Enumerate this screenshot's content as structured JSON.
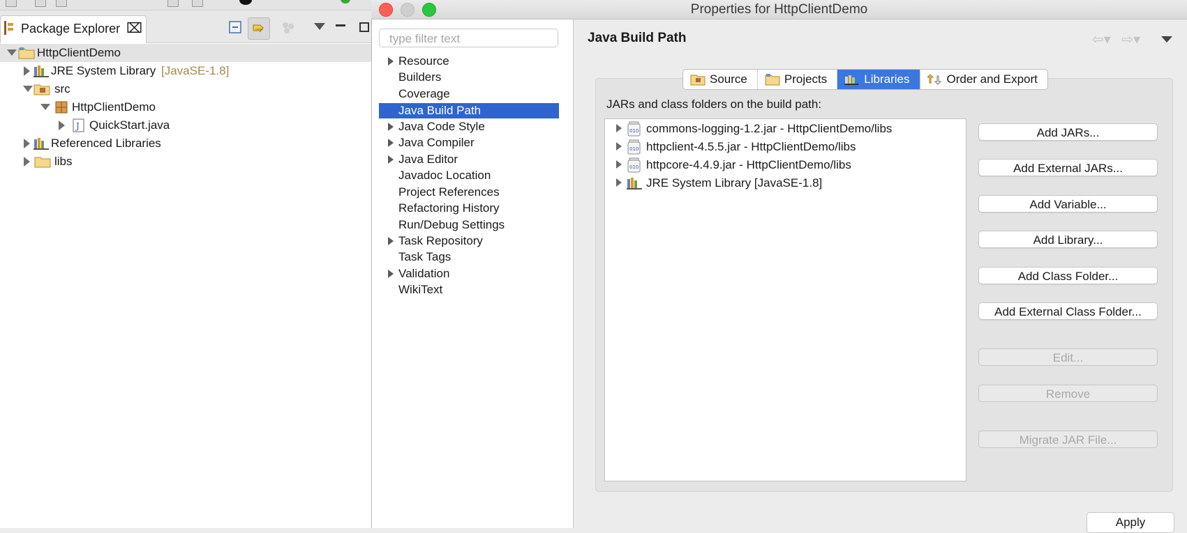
{
  "package_explorer": {
    "title": "Package Explorer",
    "close_glyph": "⌧",
    "tree": [
      {
        "label": "HttpClientDemo",
        "icon": "project-folder-icon"
      },
      {
        "label": "JRE System Library",
        "decoration": "[JavaSE-1.8]",
        "icon": "library-icon"
      },
      {
        "label": "src",
        "icon": "source-folder-icon"
      },
      {
        "label": "HttpClientDemo",
        "icon": "package-icon"
      },
      {
        "label": "QuickStart.java",
        "icon": "java-file-icon"
      },
      {
        "label": "Referenced Libraries",
        "icon": "library-icon"
      },
      {
        "label": "libs",
        "icon": "folder-icon"
      }
    ]
  },
  "dialog": {
    "title": "Properties for HttpClientDemo",
    "filter_placeholder": "type filter text",
    "nav_items": [
      {
        "label": "Resource",
        "expandable": true
      },
      {
        "label": "Builders",
        "expandable": false
      },
      {
        "label": "Coverage",
        "expandable": false
      },
      {
        "label": "Java Build Path",
        "expandable": false,
        "selected": true
      },
      {
        "label": "Java Code Style",
        "expandable": true
      },
      {
        "label": "Java Compiler",
        "expandable": true
      },
      {
        "label": "Java Editor",
        "expandable": true
      },
      {
        "label": "Javadoc Location",
        "expandable": false
      },
      {
        "label": "Project References",
        "expandable": false
      },
      {
        "label": "Refactoring History",
        "expandable": false
      },
      {
        "label": "Run/Debug Settings",
        "expandable": false
      },
      {
        "label": "Task Repository",
        "expandable": true
      },
      {
        "label": "Task Tags",
        "expandable": false
      },
      {
        "label": "Validation",
        "expandable": true
      },
      {
        "label": "WikiText",
        "expandable": false
      }
    ],
    "page_title": "Java Build Path",
    "tabs": [
      {
        "label": "Source",
        "icon": "source-tab-icon",
        "active": false
      },
      {
        "label": "Projects",
        "icon": "projects-tab-icon",
        "active": false
      },
      {
        "label": "Libraries",
        "icon": "libraries-tab-icon",
        "active": true
      },
      {
        "label": "Order and Export",
        "icon": "order-export-tab-icon",
        "active": false
      }
    ],
    "tree_label": "JARs and class folders on the build path:",
    "jars": [
      {
        "label": "commons-logging-1.2.jar - HttpClientDemo/libs",
        "icon": "jar-icon"
      },
      {
        "label": "httpclient-4.5.5.jar - HttpClientDemo/libs",
        "icon": "jar-icon"
      },
      {
        "label": "httpcore-4.4.9.jar - HttpClientDemo/libs",
        "icon": "jar-icon"
      },
      {
        "label": "JRE System Library [JavaSE-1.8]",
        "icon": "library-icon"
      }
    ],
    "buttons": {
      "add_jars": "Add JARs...",
      "add_external_jars": "Add External JARs...",
      "add_variable": "Add Variable...",
      "add_library": "Add Library...",
      "add_class_folder": "Add Class Folder...",
      "add_external_class_folder": "Add External Class Folder...",
      "edit": "Edit...",
      "remove": "Remove",
      "migrate_jar": "Migrate JAR File...",
      "apply": "Apply"
    },
    "colors": {
      "selection": "#2f64d1",
      "active_tab": "#3a78e0",
      "close_light": "#fe5f57",
      "minimize_light": "#cfcfcf",
      "zoom_light": "#28c840"
    }
  }
}
